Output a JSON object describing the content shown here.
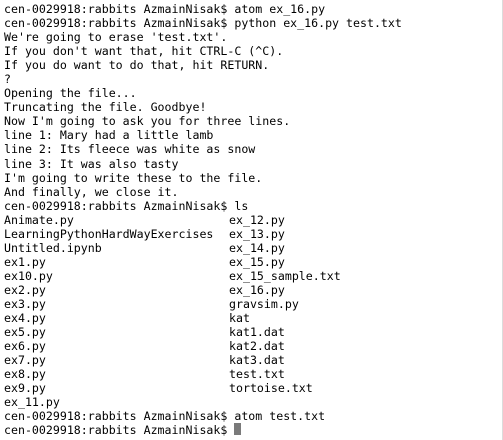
{
  "terminal": {
    "lines_before": [
      "cen-0029918:rabbits AzmainNisak$ atom ex_16.py",
      "cen-0029918:rabbits AzmainNisak$ python ex_16.py test.txt",
      "We're going to erase 'test.txt'.",
      "If you don't want that, hit CTRL-C (^C).",
      "If you do want to do that, hit RETURN.",
      "?",
      "Opening the file...",
      "Truncating the file. Goodbye!",
      "Now I'm going to ask you for three lines.",
      "line 1: Mary had a little lamb",
      "line 2: Its fleece was white as snow",
      "line 3: It was also tasty",
      "I'm going to write these to the file.",
      "And finally, we close it.",
      "cen-0029918:rabbits AzmainNisak$ ls"
    ],
    "ls_rows": [
      {
        "left": "Animate.py",
        "right": "ex_12.py"
      },
      {
        "left": "LearningPythonHardWayExercises",
        "right": "ex_13.py"
      },
      {
        "left": "Untitled.ipynb",
        "right": "ex_14.py"
      },
      {
        "left": "ex1.py",
        "right": "ex_15.py"
      },
      {
        "left": "ex10.py",
        "right": "ex_15_sample.txt"
      },
      {
        "left": "ex2.py",
        "right": "ex_16.py"
      },
      {
        "left": "ex3.py",
        "right": "gravsim.py"
      },
      {
        "left": "ex4.py",
        "right": "kat"
      },
      {
        "left": "ex5.py",
        "right": "kat1.dat"
      },
      {
        "left": "ex6.py",
        "right": "kat2.dat"
      },
      {
        "left": "ex7.py",
        "right": "kat3.dat"
      },
      {
        "left": "ex8.py",
        "right": "test.txt"
      },
      {
        "left": "ex9.py",
        "right": "tortoise.txt"
      },
      {
        "left": "ex_11.py",
        "right": ""
      }
    ],
    "lines_after": [
      "cen-0029918:rabbits AzmainNisak$ atom test.txt"
    ],
    "prompt": "cen-0029918:rabbits AzmainNisak$ "
  }
}
